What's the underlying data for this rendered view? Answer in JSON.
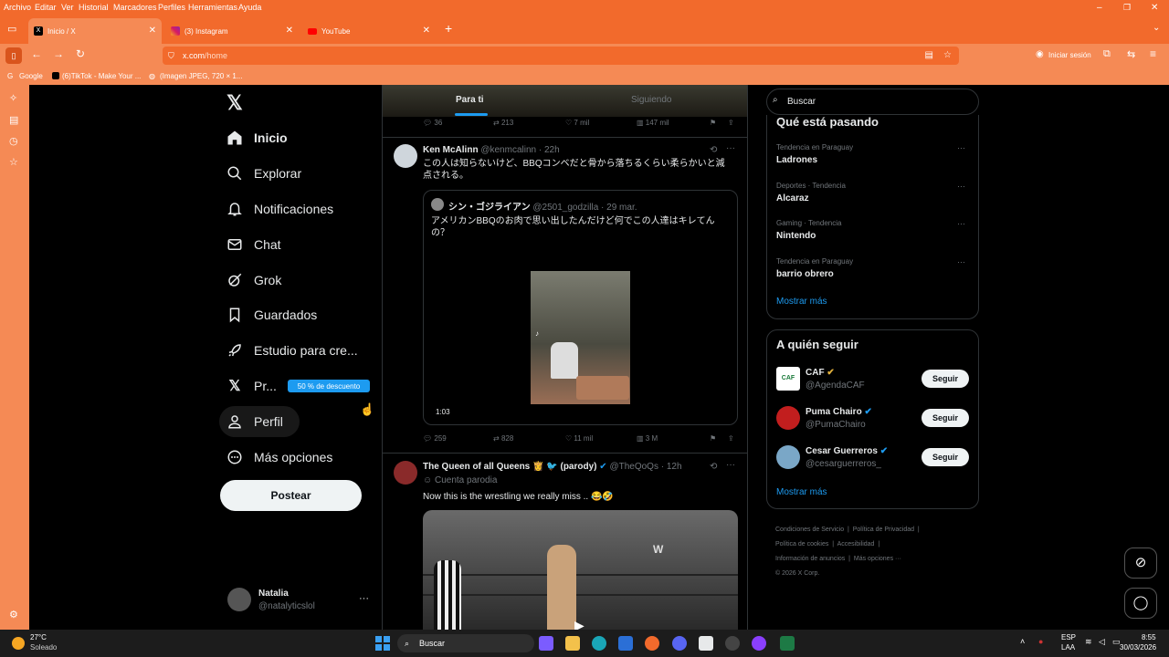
{
  "browser": {
    "menu": [
      "Archivo",
      "Editar",
      "Ver",
      "Historial",
      "Marcadores",
      "Perfiles",
      "Herramientas",
      "Ayuda"
    ],
    "tabs": [
      {
        "title": "Inicio / X"
      },
      {
        "title": "(3) Instagram"
      },
      {
        "title": "YouTube"
      }
    ],
    "url_host": "x.com",
    "url_path": "/home",
    "sign_in": "Iniciar sesión",
    "bookmarks": [
      "Google",
      "(6)TikTok - Make Your ...",
      "(Imagen JPEG, 720 × 1..."
    ]
  },
  "nav": {
    "items": [
      "Inicio",
      "Explorar",
      "Notificaciones",
      "Chat",
      "Grok",
      "Guardados",
      "Estudio para cre...",
      "Pr...",
      "Perfil",
      "Más opciones"
    ],
    "premium_badge": "50 % de descuento",
    "post_button": "Postear",
    "user_name": "Natalia",
    "user_handle": "@natalyticslol"
  },
  "feed": {
    "tabs": [
      "Para ti",
      "Siguiendo"
    ],
    "top_actions": {
      "replies": "36",
      "reposts": "213",
      "likes": "7 mil",
      "views": "147 mil"
    },
    "tweet1": {
      "name": "Ken McAlinn",
      "handle": "@kenmcalinn",
      "time": "· 22h",
      "text": "この人は知らないけど、BBQコンベだと骨から落ちるくらい柔らかいと減点される。",
      "quote_name": "シン・ゴジライアン",
      "quote_handle": "@2501_godzilla",
      "quote_time": "· 29 mar.",
      "quote_text": "アメリカンBBQのお肉で思い出したんだけど何でこの人達はキレてんの？",
      "video_duration": "1:03",
      "replies": "259",
      "reposts": "828",
      "likes": "11 mil",
      "views": "3 M"
    },
    "tweet2": {
      "name": "The Queen of all Queens 👸 🐦 (parody)",
      "handle": "@TheQoQs",
      "time": "· 12h",
      "label": "Cuenta parodia",
      "text": "Now this is the wrestling we really miss .. 😂🤣"
    }
  },
  "right": {
    "search_placeholder": "Buscar",
    "trends_title": "Qué está pasando",
    "trends": [
      {
        "context": "Tendencia en Paraguay",
        "name": "Ladrones"
      },
      {
        "context": "Deportes · Tendencia",
        "name": "Alcaraz"
      },
      {
        "context": "Gaming · Tendencia",
        "name": "Nintendo"
      },
      {
        "context": "Tendencia en Paraguay",
        "name": "barrio obrero"
      }
    ],
    "show_more": "Mostrar más",
    "follow_title": "A quién seguir",
    "follow": [
      {
        "name": "CAF",
        "handle": "@AgendaCAF",
        "button": "Seguir"
      },
      {
        "name": "Puma Chairo",
        "handle": "@PumaChairo",
        "button": "Seguir"
      },
      {
        "name": "Cesar Guerreros",
        "handle": "@cesarguerreros_",
        "button": "Seguir"
      }
    ],
    "footer": [
      "Condiciones de Servicio",
      "Política de Privacidad",
      "Política de cookies",
      "Accesibilidad",
      "Información de anuncios",
      "Más opciones ···",
      "© 2026 X Corp."
    ]
  },
  "taskbar": {
    "weather_temp": "27°C",
    "weather_text": "Soleado",
    "search": "Buscar",
    "lang1": "ESP",
    "lang2": "LAA",
    "time": "8:55",
    "date": "30/03/2026"
  }
}
